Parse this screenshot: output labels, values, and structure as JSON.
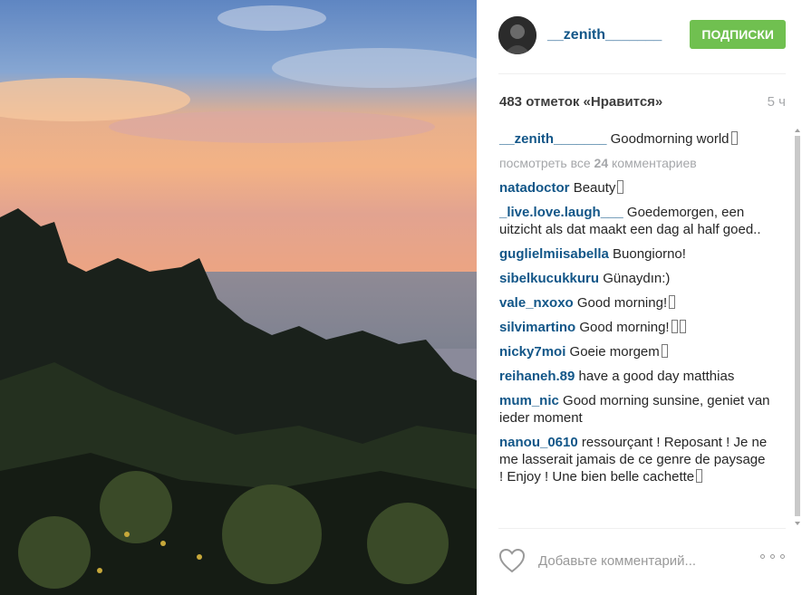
{
  "post": {
    "username": "__zenith_______",
    "follow_label": "ПОДПИСКИ",
    "likes_text": "483 отметок «Нравится»",
    "time_ago": "5 ч"
  },
  "caption": {
    "user": "__zenith_______",
    "text": "Goodmorning world"
  },
  "view_all": {
    "prefix": "посмотреть все",
    "count": "24",
    "suffix": "комментариев"
  },
  "comments": [
    {
      "user": "natadoctor",
      "text": "Beauty",
      "glyph": true
    },
    {
      "user": "_live.love.laugh___",
      "text": "Goedemorgen, een uitzicht als dat maakt een dag al half goed..",
      "glyph": false
    },
    {
      "user": "guglielmiisabella",
      "text": "Buongiorno!",
      "glyph": false
    },
    {
      "user": "sibelkucukkuru",
      "text": "Günaydın:)",
      "glyph": false
    },
    {
      "user": "vale_nxoxo",
      "text": "Good morning!",
      "glyph": true
    },
    {
      "user": "silvimartino",
      "text": "Good morning!",
      "glyph": true,
      "double": true
    },
    {
      "user": "nicky7moi",
      "text": "Goeie morgem",
      "glyph": true
    },
    {
      "user": "reihaneh.89",
      "text": "have a good day matthias",
      "glyph": false
    },
    {
      "user": "mum_nic",
      "text": "Good morning sunsine, geniet van ieder moment",
      "glyph": false
    },
    {
      "user": "nanou_0610",
      "text": "ressourçant ! Reposant ! Je ne me lasserait jamais de ce genre de paysage ! Enjoy ! Une bien belle cachette",
      "glyph": true
    }
  ],
  "footer": {
    "placeholder": "Добавьте комментарий..."
  },
  "icons": {
    "like": "heart-outline-icon",
    "more": "ellipsis-icon"
  },
  "colors": {
    "username": "#125688",
    "follow": "#70c050",
    "muted": "#a5a7aa"
  }
}
